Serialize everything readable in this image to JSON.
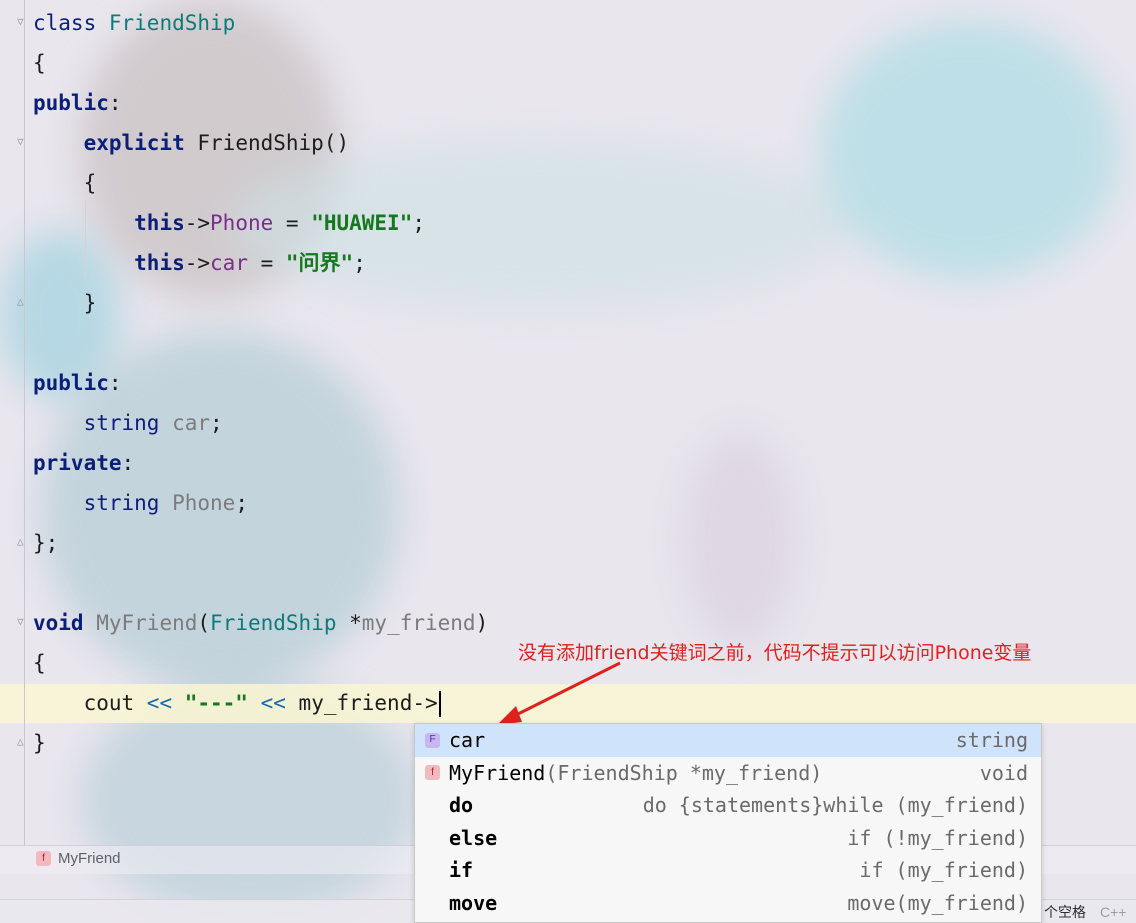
{
  "code": {
    "l1_kw": "class",
    "l1_name": "FriendShip",
    "l2": "{",
    "l3_kw": "public",
    "l3_colon": ":",
    "l4_kw": "explicit",
    "l4_rest": "FriendShip()",
    "l5": "{",
    "l6_this": "this",
    "l6_arrow": "->",
    "l6_mem": "Phone",
    "l6_eq": " = ",
    "l6_str": "\"HUAWEI\"",
    "l6_end": ";",
    "l7_this": "this",
    "l7_arrow": "->",
    "l7_mem": "car",
    "l7_eq": " = ",
    "l7_str": "\"问界\"",
    "l7_end": ";",
    "l8": "}",
    "l10_kw": "public",
    "l10_colon": ":",
    "l11_type": "string",
    "l11_name": "car",
    "l11_end": ";",
    "l12_kw": "private",
    "l12_colon": ":",
    "l13_type": "string",
    "l13_name": "Phone",
    "l13_end": ";",
    "l14": "};",
    "l16_kw": "void",
    "l16_fn": "MyFriend",
    "l16_p1": "(",
    "l16_type": "FriendShip",
    "l16_star": " *",
    "l16_param": "my_friend",
    "l16_p2": ")",
    "l17": "{",
    "l18_cout": "cout ",
    "l18_op1": "<<",
    "l18_str": " \"---\" ",
    "l18_op2": "<<",
    "l18_rest": " my_friend->",
    "l19": "}"
  },
  "annotation": "没有添加friend关键词之前，代码不提示可以访问Phone变量",
  "breadcrumb": {
    "label": "MyFriend",
    "icon_letter": "f"
  },
  "status": {
    "indent": "个空格",
    "lang": "C++"
  },
  "completion": [
    {
      "name": "car",
      "sig": "",
      "right": "string",
      "icon": "field",
      "letter": "F"
    },
    {
      "name": "MyFriend",
      "sig": "(FriendShip *my_friend)",
      "right": "void",
      "icon": "func",
      "letter": "f"
    },
    {
      "name": "do",
      "sig": "",
      "right": "do {statements}while (my_friend)",
      "icon": "none",
      "letter": ""
    },
    {
      "name": "else",
      "sig": "",
      "right": "if (!my_friend)",
      "icon": "none",
      "letter": ""
    },
    {
      "name": "if",
      "sig": "",
      "right": "if (my_friend)",
      "icon": "none",
      "letter": ""
    },
    {
      "name": "move",
      "sig": "",
      "right": "move(my_friend)",
      "icon": "none",
      "letter": ""
    }
  ],
  "colors": {
    "keyword": "#0b1e78",
    "type": "#0d7a7a",
    "member": "#7a2e8a",
    "string": "#16781e",
    "annotation": "#e0201b",
    "selection": "#cfe3fb"
  }
}
